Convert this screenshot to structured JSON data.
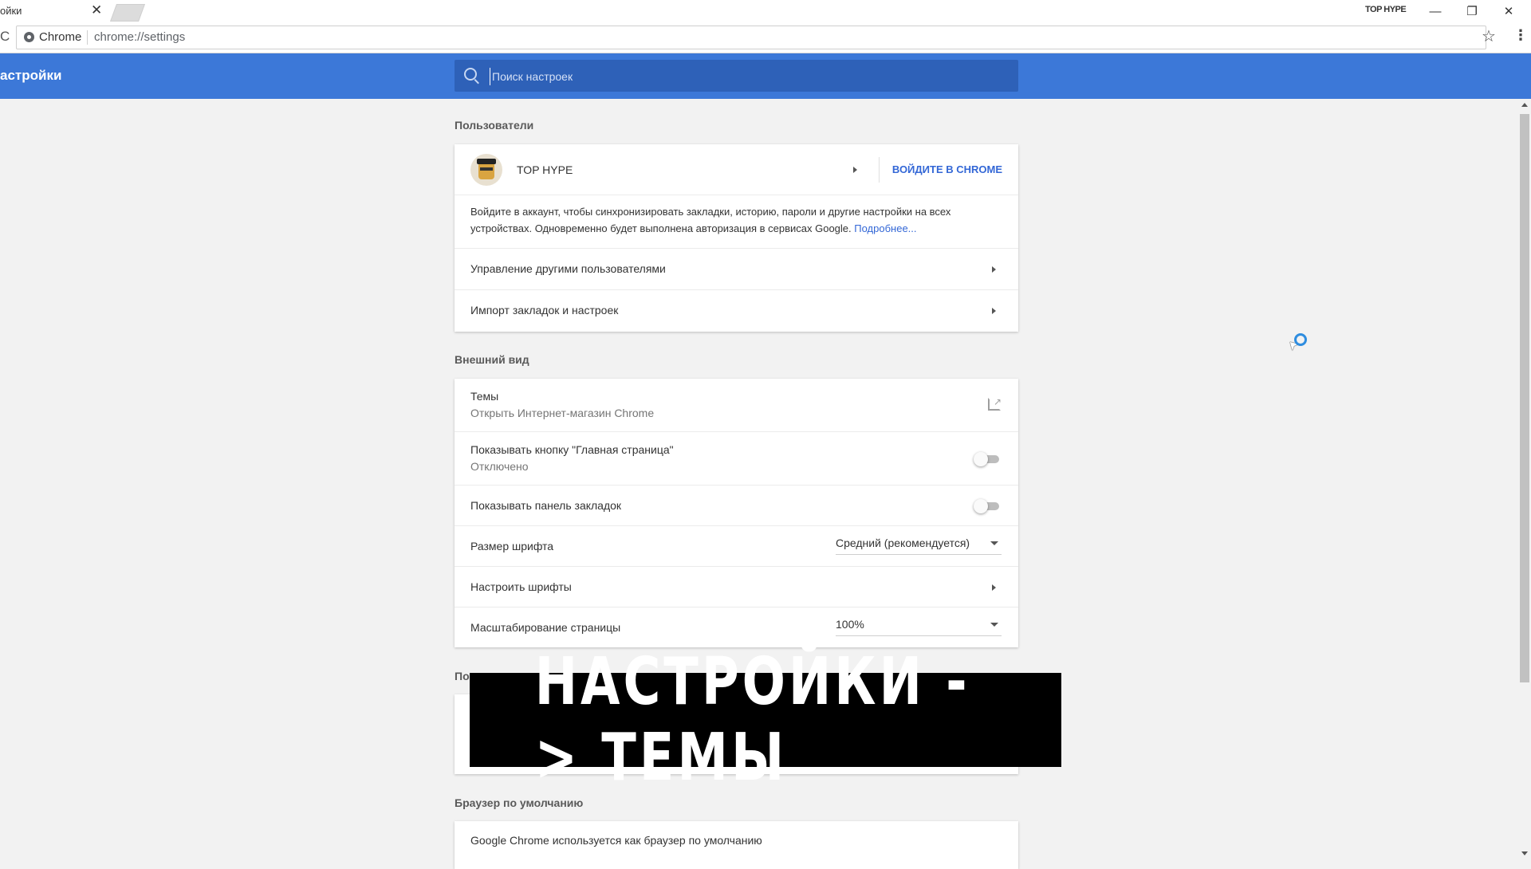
{
  "window": {
    "tab_title": "ойки",
    "tab_close": "✕",
    "user_name": "TOP HYPE",
    "min": "—",
    "restore": "❐",
    "close": "✕"
  },
  "toolbar": {
    "chip": "Chrome",
    "url": "chrome://settings",
    "star": "☆",
    "menu": "⋮",
    "reload": "C"
  },
  "header": {
    "title": "астройки",
    "search_placeholder": "Поиск настроек"
  },
  "users": {
    "section_title": "Пользователи",
    "profile_name": "TOP HYPE",
    "signin_button": "ВОЙДИТЕ В CHROME",
    "signin_text": "Войдите в аккаунт, чтобы синхронизировать закладки, историю, пароли и другие настройки на всех устройствах. Одновременно будет выполнена авторизация в сервисах Google.",
    "learn_more": "Подробнее...",
    "manage_users": "Управление другими пользователями",
    "import": "Импорт закладок и настроек"
  },
  "appearance": {
    "section_title": "Внешний вид",
    "themes_label": "Темы",
    "themes_sub": "Открыть Интернет-магазин Chrome",
    "home_button_label": "Показывать кнопку \"Главная страница\"",
    "home_button_sub": "Отключено",
    "bookmarks_bar_label": "Показывать панель закладок",
    "font_size_label": "Размер шрифта",
    "font_size_value": "Средний (рекомендуется)",
    "customize_fonts_label": "Настроить шрифты",
    "zoom_label": "Масштабирование страницы",
    "zoom_value": "100%"
  },
  "hidden_section_title": "По",
  "default_browser": {
    "section_title": "Браузер по умолчанию",
    "text": "Google Chrome используется как браузер по умолчанию"
  },
  "banner": {
    "text": "НАСТРОЙКИ -> ТЕМЫ"
  },
  "colors": {
    "header_blue": "#3c78d8",
    "link_blue": "#3367d6"
  }
}
